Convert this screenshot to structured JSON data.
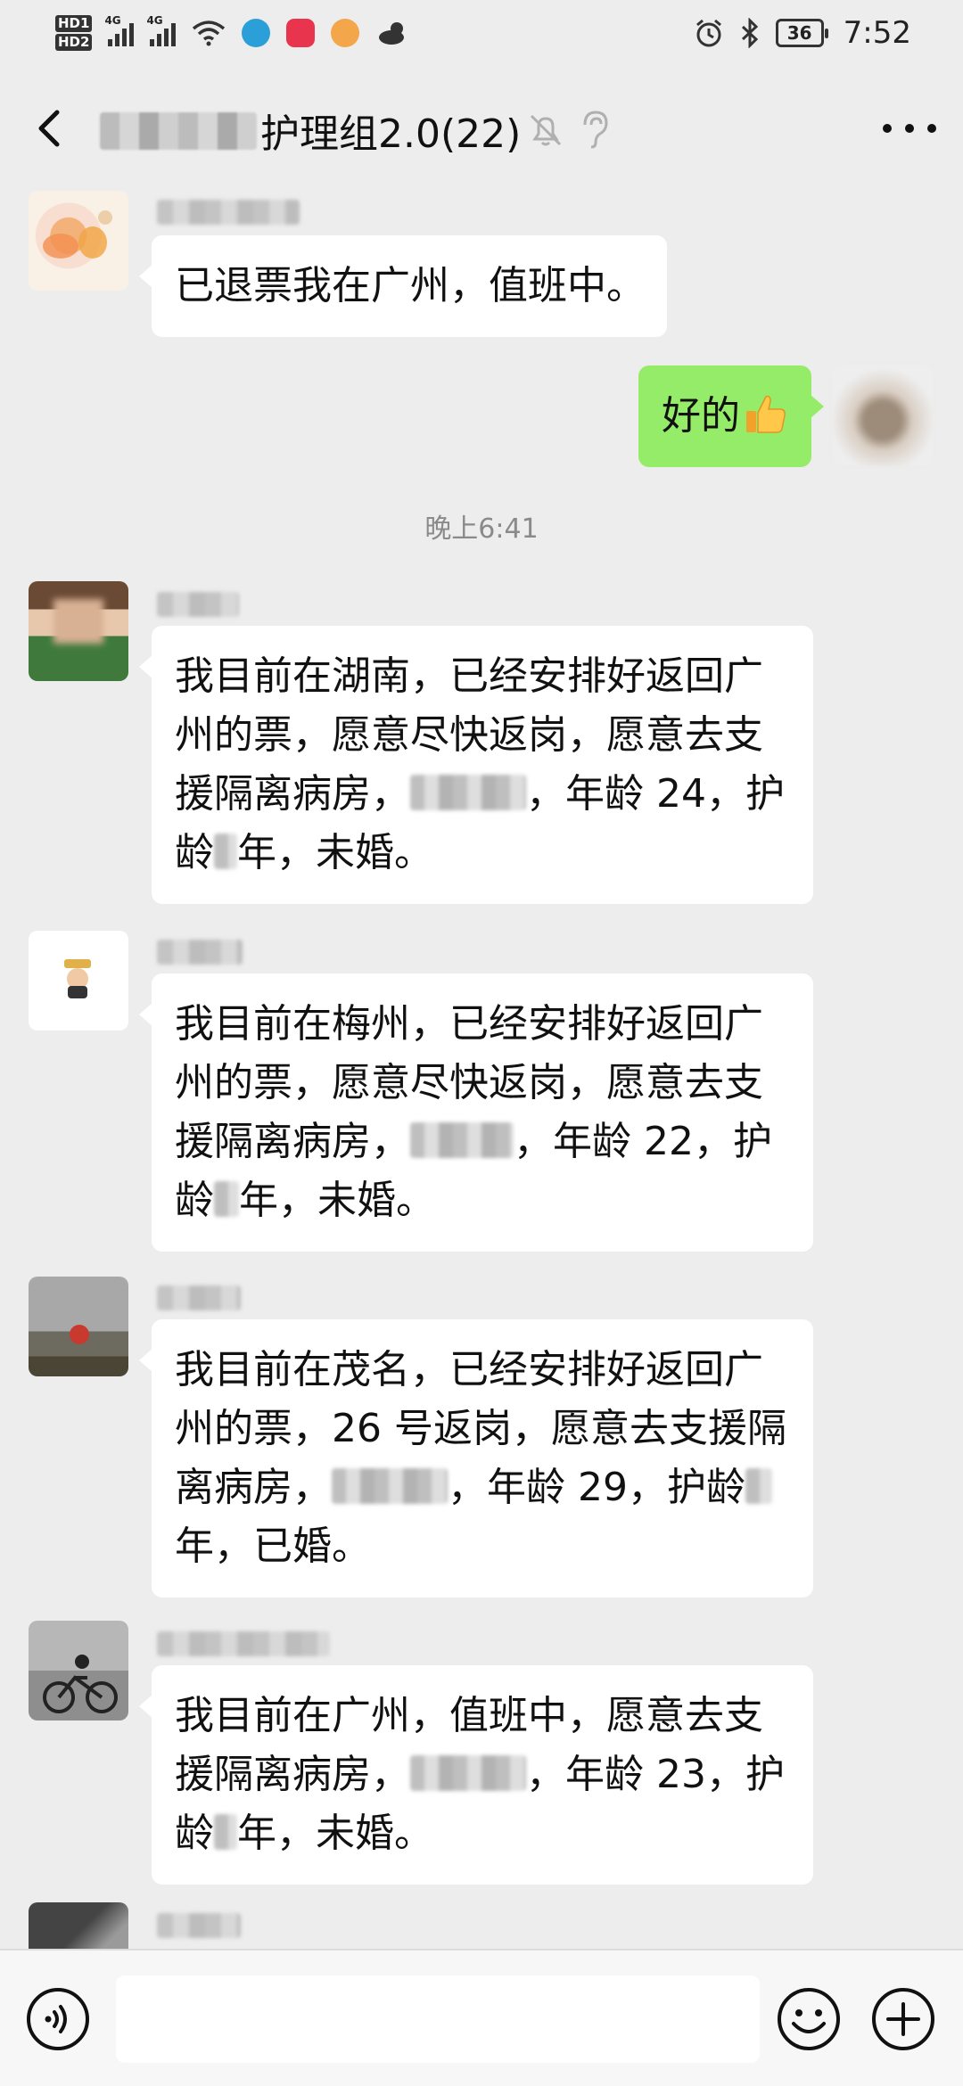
{
  "status_bar": {
    "hd1": "HD",
    "hd1_sub": "1",
    "hd2": "HD",
    "hd2_sub": "2",
    "net1": "4G",
    "net2": "4G",
    "battery": "36",
    "time": "7:52",
    "icons": [
      "signal-icon",
      "signal-icon",
      "wifi-icon",
      "app-icon",
      "app-icon",
      "app-icon",
      "weather-icon",
      "alarm-icon",
      "bluetooth-icon",
      "battery-icon"
    ]
  },
  "header": {
    "title": "护理组2.0(22)",
    "icons": [
      "back-icon",
      "mute-icon",
      "ear-icon",
      "more-icon"
    ]
  },
  "messages": [
    {
      "id": "m1",
      "from": "other",
      "text": [
        "已退票我在广州，值班中。"
      ]
    },
    {
      "id": "m2",
      "from": "me",
      "text": "好的",
      "emoji": "thumbs-up-icon"
    },
    {
      "id": "ts1",
      "type": "timestamp",
      "text": "晚上6:41"
    },
    {
      "id": "m3",
      "from": "other",
      "lines": [
        "我目前在湖南，已经安排好返回广",
        "州的票，愿意尽快返岗，愿意去支",
        "援隔离病房，",
        "，年龄 24，护",
        "龄",
        "年，未婚。"
      ]
    },
    {
      "id": "m4",
      "from": "other",
      "lines": [
        "我目前在梅州，已经安排好返回广",
        "州的票，愿意尽快返岗，愿意去支",
        "援隔离病房，",
        "，年龄 22，护",
        "龄",
        "年，未婚。"
      ]
    },
    {
      "id": "m5",
      "from": "other",
      "lines": [
        "我目前在茂名，已经安排好返回广",
        "州的票，26 号返岗，愿意去支援隔",
        "离病房，",
        "，年龄 29，护龄",
        "年，已婚。"
      ]
    },
    {
      "id": "m6",
      "from": "other",
      "lines": [
        "我目前在广州，值班中，愿意去支",
        "援隔离病房，",
        "，年龄 23，护",
        "龄",
        "年，未婚。"
      ]
    }
  ],
  "input_bar": {
    "icons": [
      "voice-icon",
      "emoji-icon",
      "plus-icon"
    ]
  },
  "colors": {
    "background": "#ededed",
    "my_bubble": "#95ec69",
    "other_bubble": "#ffffff"
  }
}
